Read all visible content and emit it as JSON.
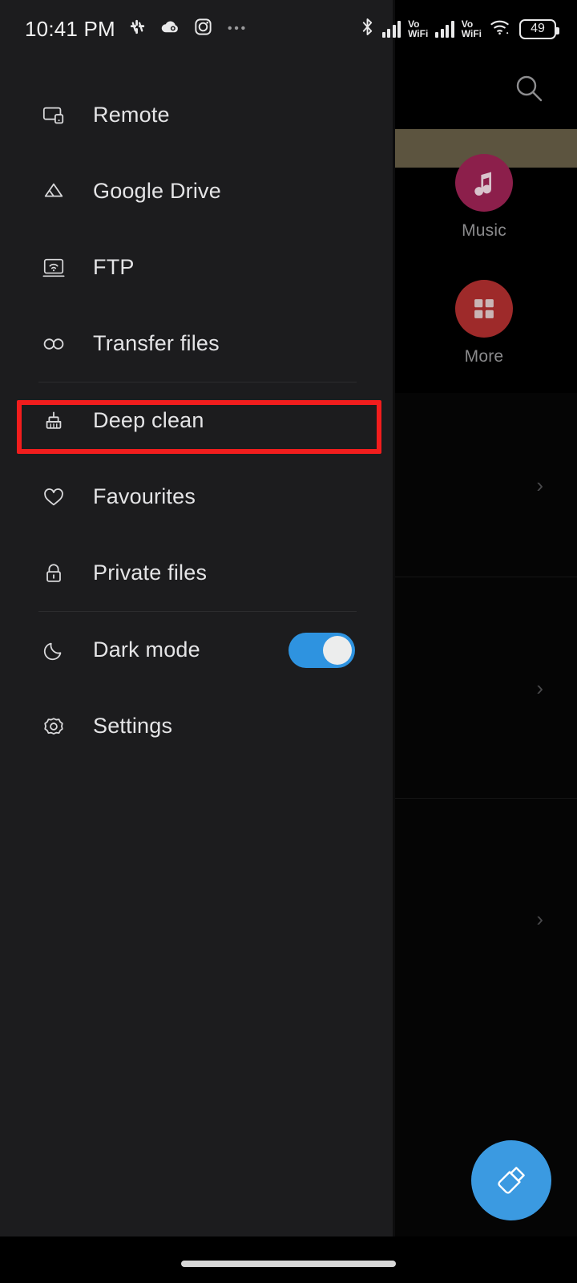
{
  "status_bar": {
    "clock": "10:41 PM",
    "left_icons": [
      "slack-icon",
      "cloud-icon",
      "instagram-icon",
      "more-dots-icon"
    ],
    "right_icons": [
      "bluetooth-icon",
      "signal-bars-sim1-icon",
      "volte-wifi-sim1-icon",
      "signal-bars-sim2-icon",
      "volte-wifi-sim2-icon",
      "wifi-icon",
      "battery-icon"
    ],
    "volte_line1": "Vo",
    "volte_line2": "WiFi",
    "battery_level": "49"
  },
  "drawer": {
    "items": [
      {
        "label": "Remote",
        "icon": "remote-screen-icon",
        "divider_after": false,
        "toggle": false
      },
      {
        "label": "Google Drive",
        "icon": "google-drive-icon",
        "divider_after": false,
        "toggle": false
      },
      {
        "label": "FTP",
        "icon": "ftp-wifi-icon",
        "divider_after": false,
        "toggle": false
      },
      {
        "label": "Transfer files",
        "icon": "transfer-files-icon",
        "divider_after": true,
        "toggle": false
      },
      {
        "label": "Deep clean",
        "icon": "broom-icon",
        "divider_after": false,
        "toggle": false
      },
      {
        "label": "Favourites",
        "icon": "heart-icon",
        "divider_after": false,
        "toggle": false
      },
      {
        "label": "Private files",
        "icon": "lock-icon",
        "divider_after": true,
        "toggle": false
      },
      {
        "label": "Dark mode",
        "icon": "moon-icon",
        "divider_after": false,
        "toggle": true
      },
      {
        "label": "Settings",
        "icon": "gear-icon",
        "divider_after": false,
        "toggle": false
      }
    ],
    "dark_mode_enabled": true,
    "highlighted_item": "Deep clean",
    "highlight_color": "#f11d1d",
    "toggle_on_color": "#2e93e0",
    "background_color": "#1c1c1e"
  },
  "background_app": {
    "search_icon": "search-icon",
    "shortcuts": [
      {
        "label": "Music",
        "icon": "music-note-icon",
        "color": "#8c1f4b"
      },
      {
        "label": "More",
        "icon": "grid-squares-icon",
        "color": "#9e2a2a"
      }
    ],
    "list_rows": [
      {
        "chevron": "chevron-right-icon"
      },
      {
        "chevron": "chevron-right-icon"
      },
      {
        "chevron": "chevron-right-icon"
      }
    ],
    "fab": {
      "icon": "brush-icon",
      "color": "#3b9ae1"
    },
    "highlight_bar_color": "#5c543f"
  }
}
